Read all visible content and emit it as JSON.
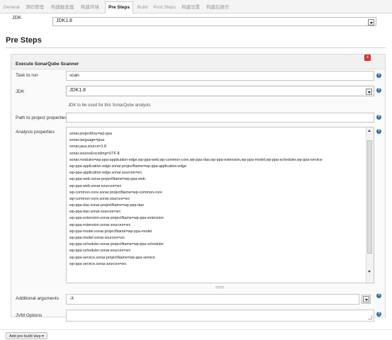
{
  "tabs": [
    {
      "label": "General",
      "active": false
    },
    {
      "label": "源码管理",
      "active": false
    },
    {
      "label": "构建触发器",
      "active": false
    },
    {
      "label": "构建环境",
      "active": false
    },
    {
      "label": "Pre Steps",
      "active": true
    },
    {
      "label": "Build",
      "active": false
    },
    {
      "label": "Post Steps",
      "active": false
    },
    {
      "label": "构建设置",
      "active": false
    },
    {
      "label": "构建后操作",
      "active": false
    }
  ],
  "top_jdk": {
    "label": "JDK",
    "value": "JDK1.8"
  },
  "section": {
    "title": "Pre Steps"
  },
  "builder": {
    "title": "Execute SonarQube Scanner",
    "close": "x",
    "task": {
      "label": "Task to run",
      "value": "scan"
    },
    "jdk": {
      "label": "JDK",
      "value": "JDK1.8",
      "hint": "JDK to be used for this SonarQube analysis"
    },
    "path": {
      "label": "Path to project properties",
      "value": ""
    },
    "analysis": {
      "label": "Analysis properties",
      "lines": [
        "sonar.projectKey=wp-ppa",
        "sonar.language=java",
        "sonar.java.source=1.8",
        "sonar.sourceEncoding=UTF-8",
        "sonar.modules=wp-ppa-application-edge,wp-ppa-web,wp-common-core,wp-ppa-dao,wp-ppa-extension,wp-ppa-model,wp-ppa-scheduler,wp-ppa-service",
        "wp-ppa-application-edge.sonar.projectName=wp-ppa-application-edge",
        "wp-ppa-application-edge.sonar.sources=src",
        "wp-ppa-web.sonar.projectName=wp-ppa-web",
        "wp-ppa-web.sonar.sources=src",
        "wp-common-core.sonar.projectName=wp-common-core",
        "wp-common-core.sonar.sources=src",
        "wp-ppa-dao.sonar.projectName=wp-ppa-dao",
        "wp-ppa-dao.sonar.sources=src",
        "wp-ppa-extension.sonar.projectName=wp-ppa-extension",
        "wp-ppa-extension.sonar.sources=src",
        "wp-ppa-model.sonar.projectName=wp-ppa-model",
        "wp-ppa-model.sonar.sources=src",
        "wp-ppa-scheduler.sonar.projectName=wp-ppa-scheduler",
        "wp-ppa-scheduler.sonar.sources=src",
        "wp-ppa-service.sonar.projectName=wp-ppa-service",
        "wp-ppa-service.sonar.sources=src"
      ]
    },
    "additional": {
      "label": "Additional arguments",
      "value": "-X"
    },
    "jvm": {
      "label": "JVM Options",
      "value": ""
    }
  },
  "add_step_button": "Add pre-build step ▾",
  "help_glyph": "?",
  "icons": {
    "help": "help-icon",
    "close": "close-icon",
    "dropdown": "chevron-down-icon"
  },
  "colors": {
    "close": "#d9342b",
    "help": "#3c6fb6"
  }
}
